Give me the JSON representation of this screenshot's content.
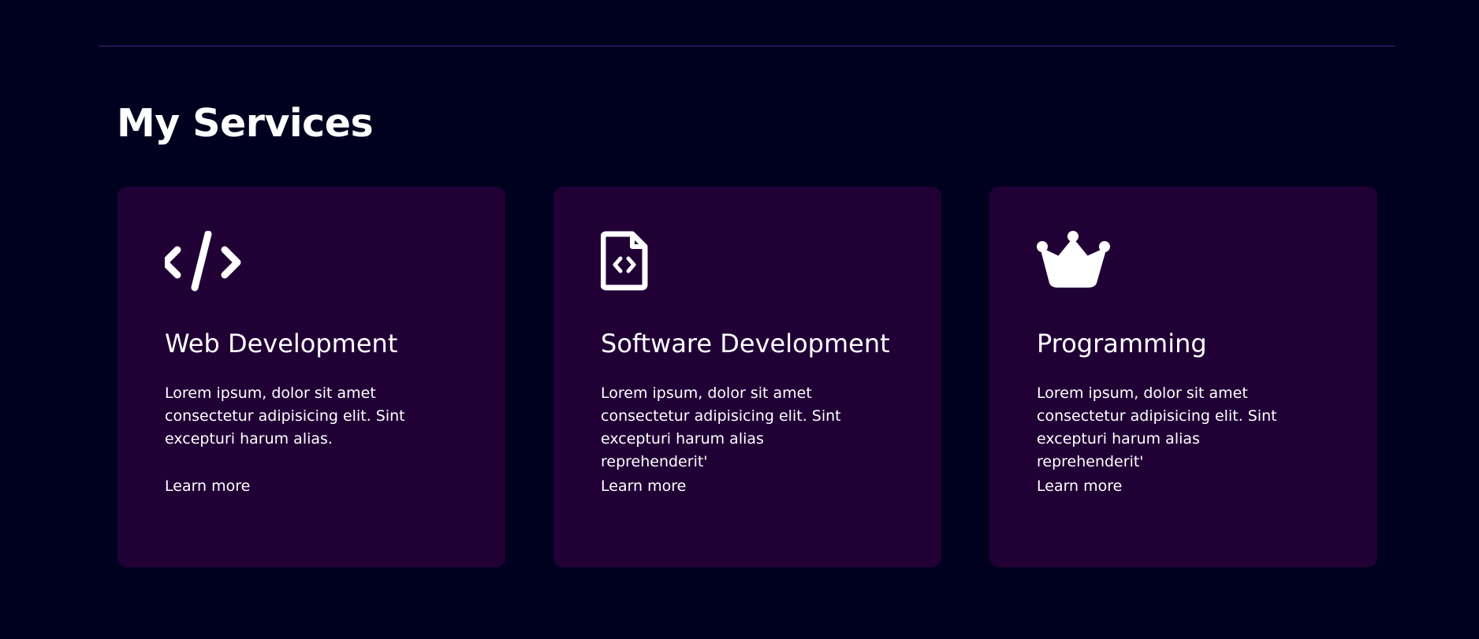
{
  "section": {
    "title": "My Services"
  },
  "colors": {
    "background": "#00001f",
    "card": "#210036",
    "divider": "#4b1f86",
    "text": "#ffffff"
  },
  "services": [
    {
      "icon": "code-icon",
      "title": "Web Development",
      "description": "Lorem ipsum, dolor sit amet consectetur adipisicing elit. Sint excepturi harum alias.",
      "link": "Learn more"
    },
    {
      "icon": "file-code-icon",
      "title": "Software Development",
      "description": "Lorem ipsum, dolor sit amet consectetur adipisicing elit. Sint excepturi harum alias reprehenderit'",
      "link": "Learn more"
    },
    {
      "icon": "crown-icon",
      "title": "Programming",
      "description": "Lorem ipsum, dolor sit amet consectetur adipisicing elit. Sint excepturi harum alias reprehenderit'",
      "link": "Learn more"
    }
  ]
}
